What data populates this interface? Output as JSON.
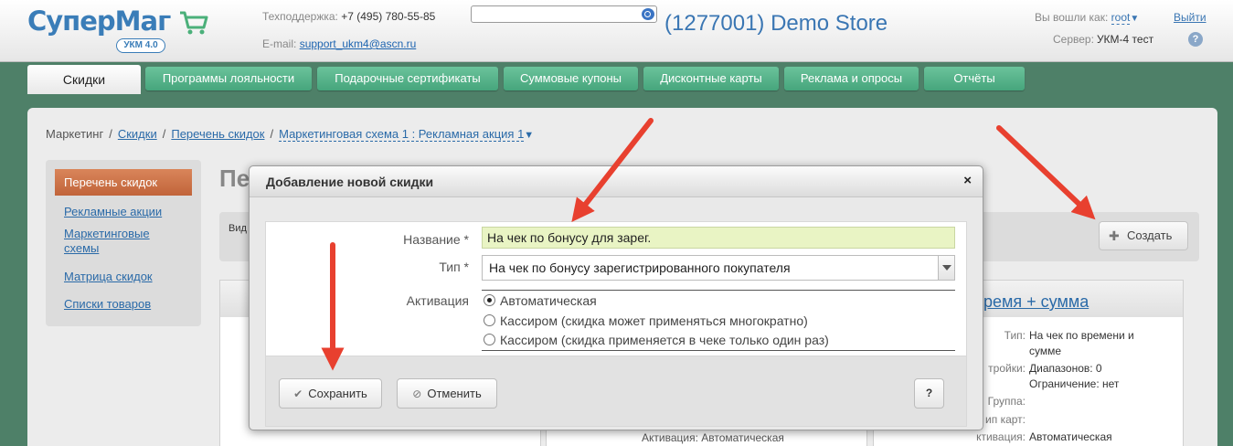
{
  "header": {
    "logo_text": "СуперМаг",
    "logo_badge": "УКМ 4.0",
    "support_label": "Техподдержка:",
    "support_phone": "+7 (495) 780-55-85",
    "email_label": "E-mail:",
    "email": "support_ukm4@ascn.ru",
    "search_value": "",
    "store_title": "(1277001) Demo Store",
    "logged_as_label": "Вы вошли как:",
    "username": "root",
    "logout": "Выйти",
    "server_label": "Сервер:",
    "server_value": "УКМ-4 тест",
    "help_label": "?"
  },
  "nav": {
    "active_tab": "Скидки",
    "tabs": [
      "Программы лояльности",
      "Подарочные сертификаты",
      "Суммовые купоны",
      "Дисконтные карты",
      "Реклама и опросы",
      "Отчёты"
    ]
  },
  "breadcrumb": {
    "root": "Маркетинг",
    "items": [
      "Скидки",
      "Перечень скидок"
    ],
    "current": "Маркетинговая схема 1 : Рекламная акция 1",
    "separator": "/"
  },
  "sidebar": {
    "active": "Перечень скидок",
    "links": [
      "Рекламные акции",
      "Маркетинговые",
      "схемы",
      "Матрица скидок",
      "Списки товаров"
    ]
  },
  "background": {
    "page_title": "Пе",
    "vid_label": "Вид",
    "create_button": "Создать",
    "card_title": "ремя + сумма",
    "card_fields": [
      {
        "label": "Тип:",
        "value": "На чек по времени и"
      },
      {
        "label": "",
        "value": "сумме"
      },
      {
        "label": "тройки:",
        "value": "Диапазонов: 0"
      },
      {
        "label": "",
        "value": "Ограничение: нет"
      },
      {
        "label": "Группа:",
        "value": ""
      },
      {
        "label": "ип карт:",
        "value": ""
      },
      {
        "label": "ктивация:",
        "value": "Автоматическая"
      }
    ],
    "mid_card_text": "Активация: Автоматическая"
  },
  "dialog": {
    "title": "Добавление новой скидки",
    "close": "×",
    "name_label": "Название *",
    "name_value": "На чек по бонусу для зарег.",
    "type_label": "Тип *",
    "type_value": "На чек по бонусу зарегистрированного покупателя",
    "activation_label": "Активация",
    "activation_options": [
      "Автоматическая",
      "Кассиром (скидка может применяться многократно)",
      "Кассиром (скидка применяется в чеке только один раз)"
    ],
    "activation_selected": 0,
    "save_button": "Сохранить",
    "cancel_button": "Отменить",
    "help_button": "?"
  },
  "colors": {
    "accent_blue": "#3a76b3",
    "tab_green": "#4fae85",
    "sidebar_active": "#c86c42",
    "arrow_red": "#e8402f",
    "input_highlight": "#e9f4c4"
  }
}
